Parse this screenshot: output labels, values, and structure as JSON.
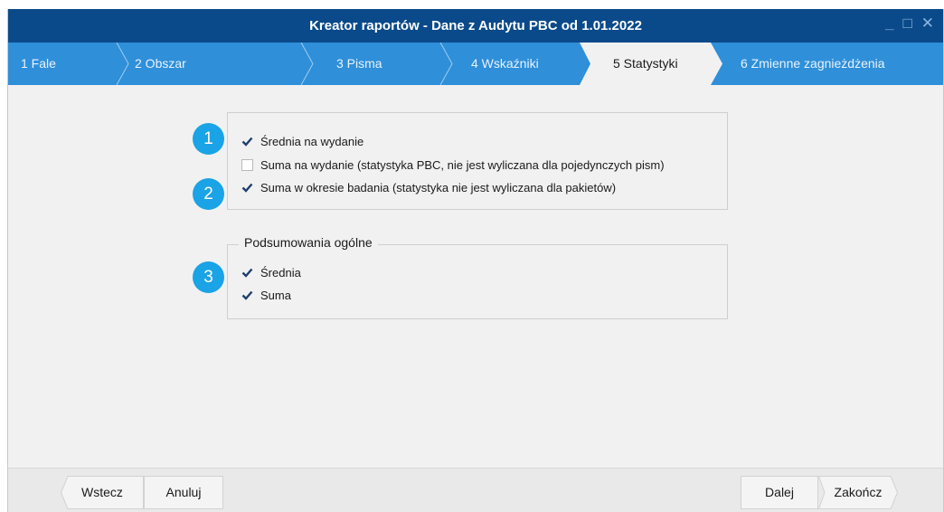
{
  "window": {
    "title": "Kreator raportów - Dane z Audytu PBC od 1.01.2022",
    "controls": {
      "minimize": "_",
      "maximize": "□",
      "close": "✕"
    }
  },
  "tabs": [
    {
      "label": "1  Fale",
      "active": false
    },
    {
      "label": "2  Obszar",
      "active": false
    },
    {
      "label": "3 Pisma",
      "active": false
    },
    {
      "label": "4 Wskaźniki",
      "active": false
    },
    {
      "label": "5 Statystyki",
      "active": true
    },
    {
      "label": "6 Zmienne zagnieżdżenia",
      "active": false
    }
  ],
  "stats_panel": {
    "options": [
      {
        "label": "Średnia na wydanie",
        "checked": true
      },
      {
        "label": "Suma na wydanie (statystyka PBC, nie jest wyliczana dla pojedynczych pism)",
        "checked": false
      },
      {
        "label": "Suma w okresie badania (statystyka nie jest wyliczana dla pakietów)",
        "checked": true
      }
    ]
  },
  "summary_panel": {
    "legend": "Podsumowania ogólne",
    "options": [
      {
        "label": "Średnia",
        "checked": true
      },
      {
        "label": "Suma",
        "checked": true
      }
    ]
  },
  "badges": [
    "1",
    "2",
    "3"
  ],
  "footer": {
    "back": "Wstecz",
    "cancel": "Anuluj",
    "next": "Dalej",
    "finish": "Zakończ"
  },
  "colors": {
    "titlebar": "#0a4a8a",
    "tabbar": "#2f8fd9",
    "active_tab": "#f1f1f1",
    "badge": "#1aa3e6",
    "checkmark": "#1f3f6e"
  }
}
